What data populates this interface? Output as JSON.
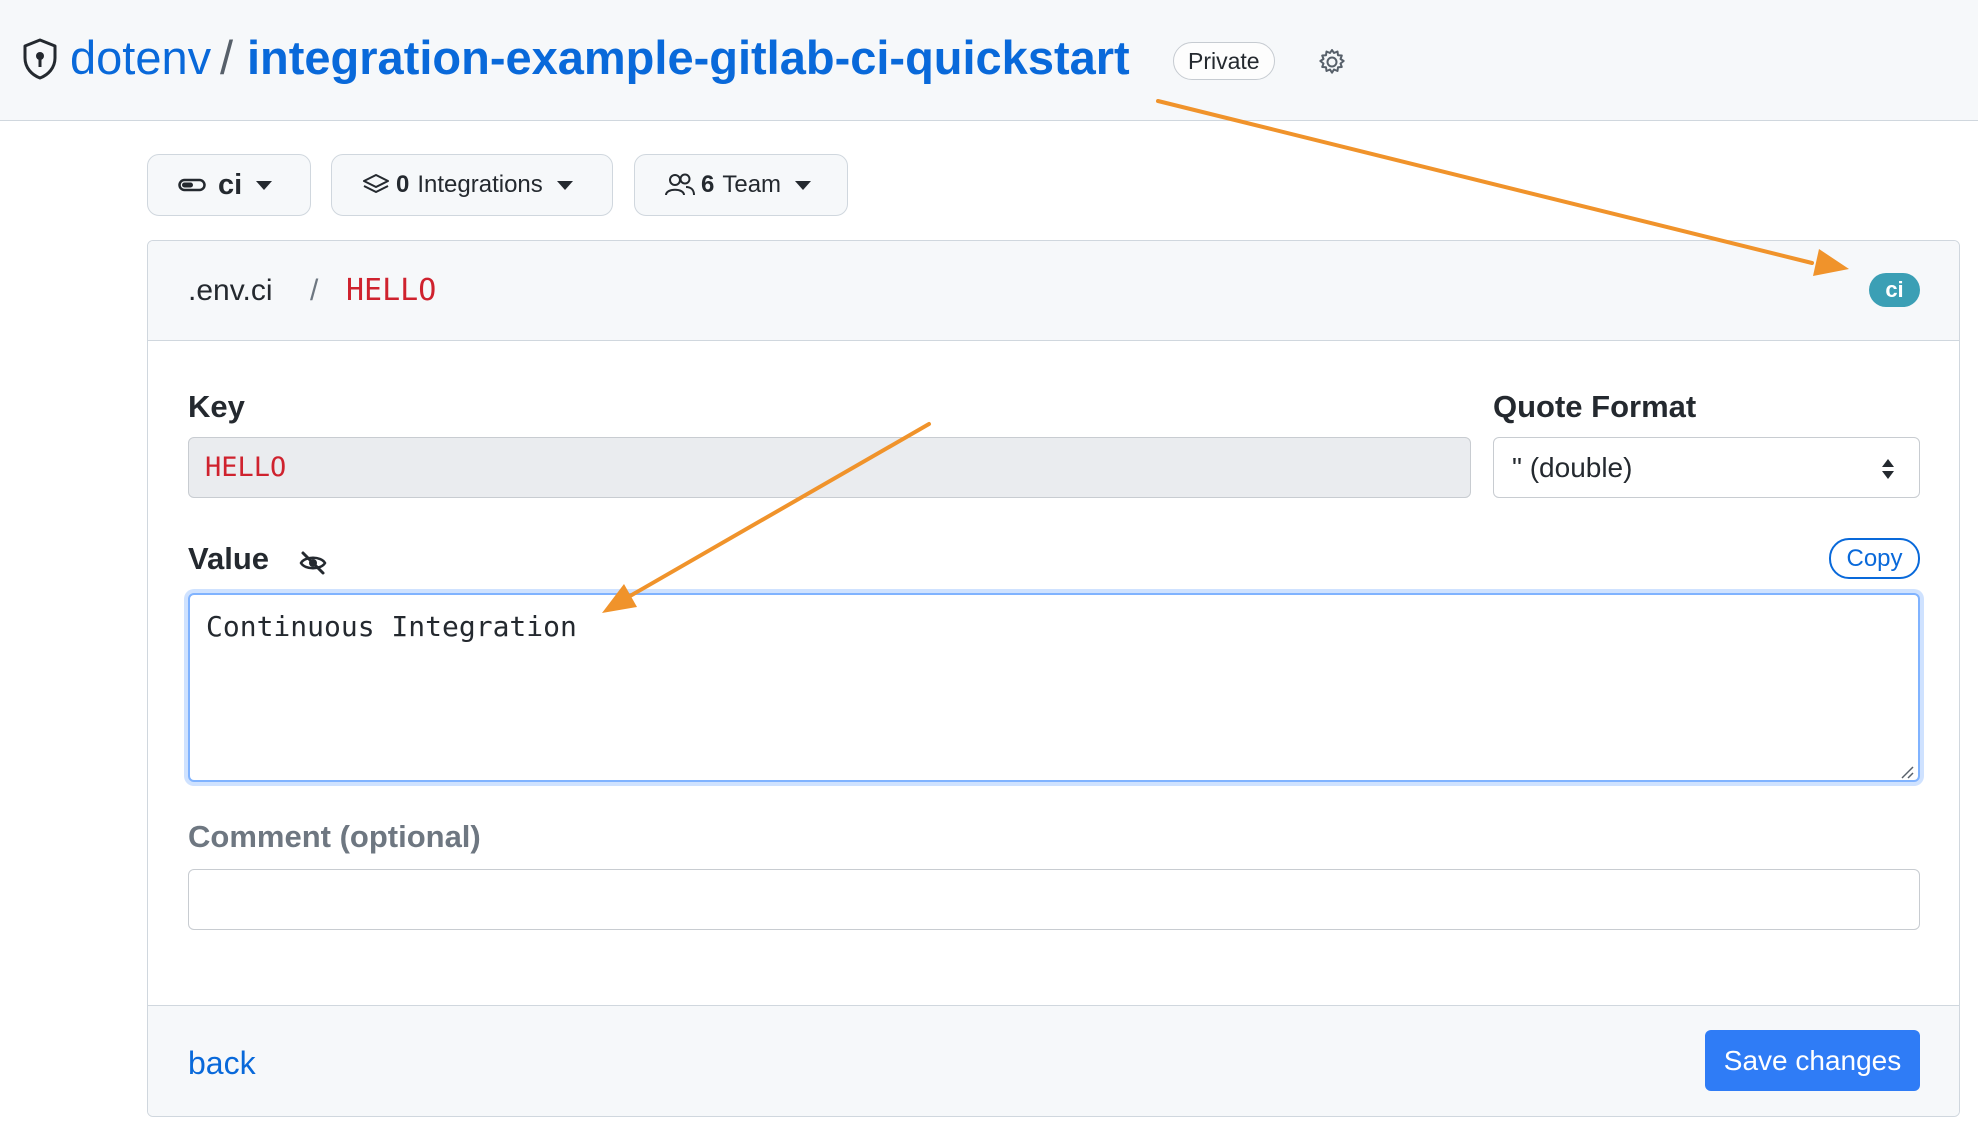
{
  "header": {
    "owner": "dotenv",
    "separator": "/",
    "repo": "integration-example-gitlab-ci-quickstart",
    "visibility": "Private"
  },
  "toolbar": {
    "environment": {
      "label": "ci"
    },
    "integrations": {
      "count": "0",
      "label": "Integrations"
    },
    "team": {
      "count": "6",
      "label": "Team"
    }
  },
  "card": {
    "breadcrumb": {
      "file": ".env.ci",
      "separator": "/",
      "key": "HELLO"
    },
    "env_badge": "ci",
    "key": {
      "label": "Key",
      "value": "HELLO"
    },
    "quote_format": {
      "label": "Quote Format",
      "selected": "\" (double)"
    },
    "value": {
      "label": "Value",
      "copy_label": "Copy",
      "text": "Continuous Integration"
    },
    "comment": {
      "label": "Comment (optional)",
      "value": ""
    },
    "footer": {
      "back_label": "back",
      "save_label": "Save changes"
    }
  },
  "colors": {
    "link": "#0969da",
    "key_red": "#cf222e",
    "env_badge": "#3b9fb5",
    "primary_button": "#2f7cf6",
    "annotation_arrow": "#f0932b"
  },
  "icons": [
    "shield-lock-icon",
    "gear-icon",
    "toggle-icon",
    "stack-icon",
    "people-icon",
    "eye-slash-icon",
    "select-arrows-icon",
    "resize-grip-icon"
  ]
}
